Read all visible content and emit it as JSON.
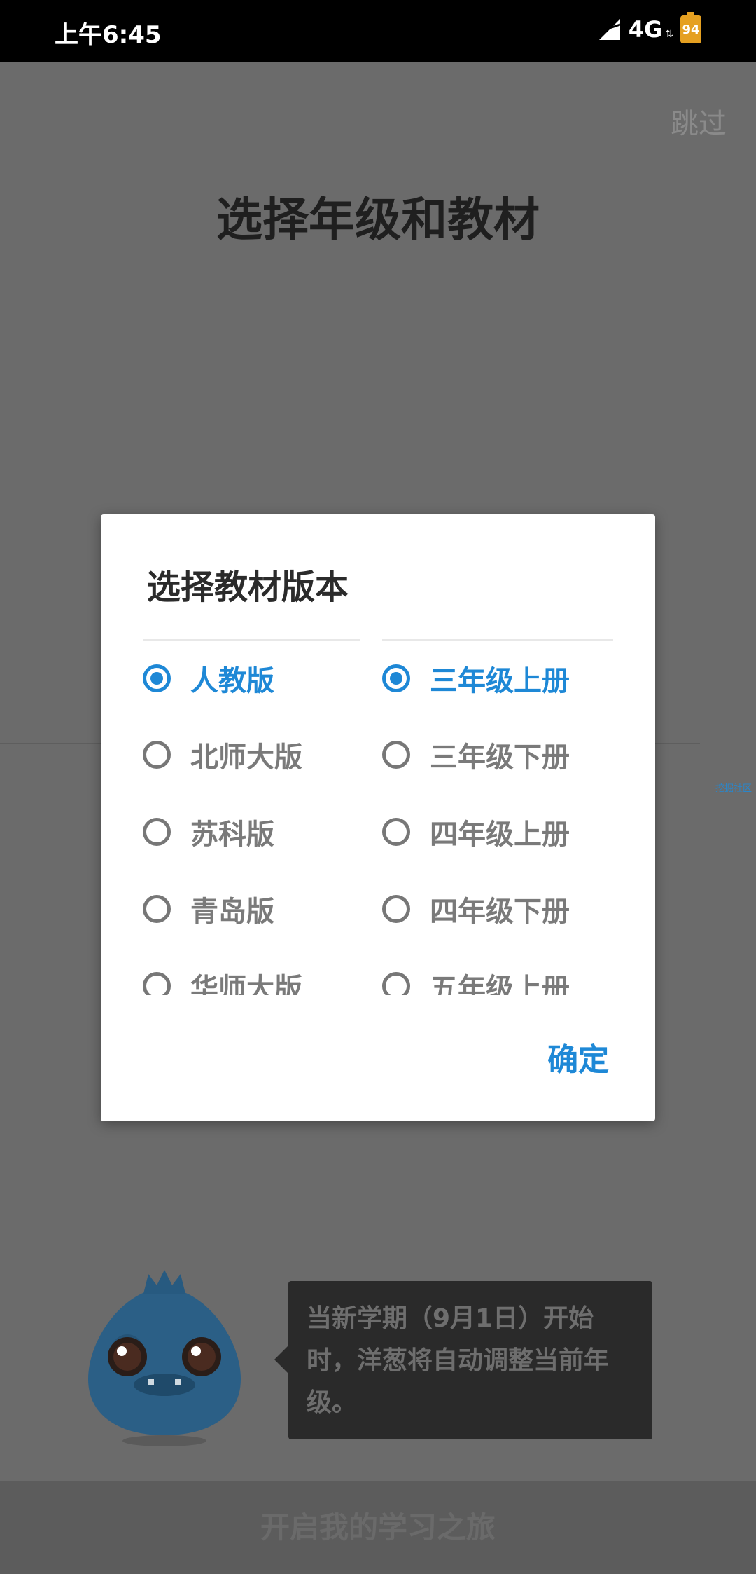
{
  "status_bar": {
    "time": "上午6:45",
    "network": "4G",
    "battery": "94"
  },
  "page": {
    "skip_label": "跳过",
    "title": "选择年级和教材",
    "tiny_link": "挖掘社区",
    "tip_text": "当新学期（9月1日）开始时，洋葱将自动调整当前年级。",
    "start_button": "开启我的学习之旅"
  },
  "dialog": {
    "title": "选择教材版本",
    "editions": [
      {
        "label": "人教版",
        "selected": true
      },
      {
        "label": "北师大版",
        "selected": false
      },
      {
        "label": "苏科版",
        "selected": false
      },
      {
        "label": "青岛版",
        "selected": false
      },
      {
        "label": "华师大版",
        "selected": false
      }
    ],
    "grades": [
      {
        "label": "三年级上册",
        "selected": true
      },
      {
        "label": "三年级下册",
        "selected": false
      },
      {
        "label": "四年级上册",
        "selected": false
      },
      {
        "label": "四年级下册",
        "selected": false
      },
      {
        "label": "五年级上册",
        "selected": false
      }
    ],
    "ok_label": "确定"
  },
  "colors": {
    "accent": "#1e88d6",
    "overlay": "#6b6b6b"
  }
}
